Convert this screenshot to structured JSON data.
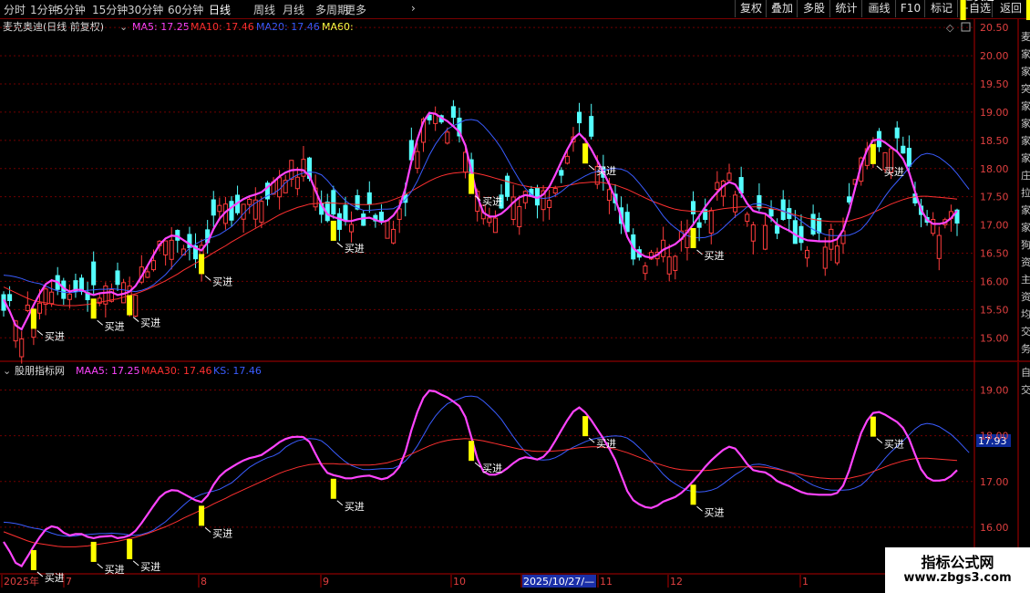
{
  "toolbar": {
    "periods": [
      "分时",
      "1分钟",
      "5分钟",
      "15分钟",
      "30分钟",
      "60分钟",
      "日线",
      "周线",
      "月线",
      "多周期",
      "更多"
    ],
    "active_period": "日线",
    "more_arrow": "›",
    "buttons": [
      "复权",
      "叠加",
      "多股",
      "统计",
      "画线",
      "F10",
      "标记",
      "+自选",
      "返回"
    ]
  },
  "main_panel": {
    "title": "麦克奥迪(日线 前复权)",
    "ma5": "MA5: 17.25",
    "ma10": "MA10: 17.46",
    "ma20": "MA20: 17.46",
    "ma60": "MA60:",
    "right_strip_text": "麦家家突家家家家庄拉家家狗资主资均交务"
  },
  "sub_panel": {
    "title": "股朋指标网",
    "maa5": "MAA5: 17.25",
    "maa30": "MAA30: 17.46",
    "ks": "KS: 17.46",
    "current_value": "17.93",
    "right_strip_text": "自交"
  },
  "date_axis": {
    "labels": [
      "2025年",
      "7",
      "8",
      "9",
      "10",
      "2025/10/27/—",
      "11",
      "12",
      "1"
    ]
  },
  "watermark": {
    "line1": "指标公式网",
    "line2": "www.zbgs3.com"
  },
  "colors": {
    "up": "#ff3c3c",
    "down": "#54ffff",
    "ma5": "#ff44ff",
    "ma10": "#ff3030",
    "ma20": "#3a5cff",
    "ma60": "#ffff44",
    "buy": "#ffff00",
    "grid": "#700000"
  },
  "chart_data": [
    {
      "type": "candlestick",
      "title": "麦克奥迪(日线 前复权)",
      "y_ticks": [
        15.0,
        15.5,
        16.0,
        16.5,
        17.0,
        17.5,
        18.0,
        18.5,
        19.0,
        19.5,
        20.0,
        20.5
      ],
      "ylim": [
        14.6,
        20.6
      ],
      "buy_signal_label": "买进",
      "buy_signals_x_index": [
        5,
        15,
        21,
        33,
        55,
        78,
        97,
        115,
        145,
        160,
        171,
        192
      ],
      "series": [
        {
          "name": "MA5",
          "values": [
            15.68,
            15.47,
            15.22,
            15.15,
            15.36,
            15.58,
            15.78,
            15.95,
            16.02,
            15.99,
            15.88,
            15.82,
            15.85,
            15.85,
            15.79,
            15.76,
            15.79,
            15.8,
            15.81,
            15.76,
            15.78,
            15.82,
            15.92,
            16.09,
            16.28,
            16.47,
            16.65,
            16.76,
            16.81,
            16.8,
            16.73,
            16.66,
            16.59,
            16.55,
            16.69,
            16.93,
            17.11,
            17.23,
            17.31,
            17.39,
            17.46,
            17.51,
            17.54,
            17.58,
            17.67,
            17.76,
            17.86,
            17.93,
            17.97,
            17.98,
            17.97,
            17.87,
            17.61,
            17.36,
            17.19,
            17.14,
            17.11,
            17.07,
            17.07,
            17.1,
            17.12,
            17.13,
            17.09,
            17.05,
            17.08,
            17.17,
            17.32,
            17.65,
            18.12,
            18.52,
            18.83,
            18.99,
            18.97,
            18.9,
            18.84,
            18.75,
            18.65,
            18.41,
            17.97,
            17.5,
            17.22,
            17.15,
            17.15,
            17.2,
            17.29,
            17.4,
            17.49,
            17.53,
            17.51,
            17.48,
            17.54,
            17.68,
            17.89,
            18.12,
            18.34,
            18.53,
            18.62,
            18.51,
            18.34,
            18.14,
            17.94,
            17.72,
            17.47,
            17.13,
            16.79,
            16.59,
            16.5,
            16.44,
            16.42,
            16.47,
            16.56,
            16.61,
            16.66,
            16.75,
            16.87,
            17.01,
            17.16,
            17.32,
            17.46,
            17.58,
            17.69,
            17.76,
            17.72,
            17.56,
            17.38,
            17.25,
            17.22,
            17.2,
            17.12,
            17.01,
            16.95,
            16.9,
            16.83,
            16.77,
            16.73,
            16.72,
            16.71,
            16.71,
            16.71,
            16.75,
            16.91,
            17.24,
            17.66,
            18.06,
            18.33,
            18.5,
            18.52,
            18.46,
            18.38,
            18.3,
            18.17,
            17.93,
            17.59,
            17.27,
            17.09,
            17.02,
            17.02,
            17.04,
            17.12,
            17.25
          ]
        },
        {
          "name": "MA20",
          "values": [
            16.11,
            16.1,
            16.08,
            16.05,
            16.01,
            15.98,
            15.96,
            15.92,
            15.87,
            15.83,
            15.81,
            15.8,
            15.81,
            15.83,
            15.84,
            15.85,
            15.86,
            15.86,
            15.87,
            15.86,
            15.85,
            15.83,
            15.82,
            15.84,
            15.88,
            15.94,
            16.03,
            16.12,
            16.24,
            16.36,
            16.48,
            16.59,
            16.66,
            16.72,
            16.76,
            16.79,
            16.83,
            16.9,
            16.97,
            17.08,
            17.2,
            17.31,
            17.39,
            17.46,
            17.52,
            17.56,
            17.63,
            17.75,
            17.83,
            17.89,
            17.92,
            17.94,
            17.93,
            17.89,
            17.79,
            17.66,
            17.54,
            17.43,
            17.35,
            17.3,
            17.26,
            17.26,
            17.27,
            17.28,
            17.28,
            17.29,
            17.35,
            17.45,
            17.59,
            17.78,
            18.01,
            18.24,
            18.43,
            18.58,
            18.7,
            18.76,
            18.81,
            18.86,
            18.87,
            18.85,
            18.76,
            18.64,
            18.51,
            18.36,
            18.17,
            17.98,
            17.8,
            17.65,
            17.54,
            17.48,
            17.47,
            17.48,
            17.52,
            17.59,
            17.68,
            17.75,
            17.81,
            17.87,
            17.92,
            17.95,
            17.97,
            17.99,
            18.0,
            17.99,
            17.95,
            17.86,
            17.74,
            17.61,
            17.46,
            17.31,
            17.16,
            17.04,
            16.95,
            16.87,
            16.81,
            16.78,
            16.77,
            16.78,
            16.81,
            16.86,
            16.95,
            17.05,
            17.15,
            17.23,
            17.32,
            17.37,
            17.38,
            17.36,
            17.32,
            17.29,
            17.25,
            17.2,
            17.15,
            17.07,
            16.99,
            16.92,
            16.87,
            16.83,
            16.81,
            16.81,
            16.81,
            16.82,
            16.86,
            16.92,
            17.04,
            17.19,
            17.35,
            17.51,
            17.65,
            17.77,
            17.89,
            18.02,
            18.15,
            18.24,
            18.27,
            18.25,
            18.2,
            18.12,
            18.03,
            17.91,
            17.77,
            17.63
          ]
        },
        {
          "name": "MA10",
          "values": [
            15.9,
            15.85,
            15.8,
            15.75,
            15.7,
            15.66,
            15.64,
            15.62,
            15.6,
            15.58,
            15.57,
            15.57,
            15.57,
            15.58,
            15.59,
            15.61,
            15.63,
            15.65,
            15.67,
            15.69,
            15.72,
            15.75,
            15.78,
            15.82,
            15.86,
            15.91,
            15.96,
            16.01,
            16.07,
            16.13,
            16.2,
            16.26,
            16.32,
            16.38,
            16.44,
            16.51,
            16.57,
            16.63,
            16.7,
            16.76,
            16.82,
            16.88,
            16.94,
            17.0,
            17.06,
            17.12,
            17.18,
            17.23,
            17.27,
            17.31,
            17.34,
            17.37,
            17.38,
            17.39,
            17.39,
            17.39,
            17.38,
            17.38,
            17.37,
            17.36,
            17.36,
            17.36,
            17.37,
            17.39,
            17.41,
            17.45,
            17.49,
            17.54,
            17.6,
            17.66,
            17.72,
            17.78,
            17.83,
            17.87,
            17.9,
            17.92,
            17.93,
            17.94,
            17.93,
            17.91,
            17.89,
            17.86,
            17.83,
            17.8,
            17.77,
            17.74,
            17.71,
            17.69,
            17.67,
            17.66,
            17.66,
            17.66,
            17.67,
            17.68,
            17.7,
            17.72,
            17.74,
            17.75,
            17.76,
            17.76,
            17.75,
            17.73,
            17.71,
            17.67,
            17.63,
            17.58,
            17.53,
            17.48,
            17.43,
            17.39,
            17.35,
            17.31,
            17.28,
            17.26,
            17.25,
            17.24,
            17.24,
            17.24,
            17.25,
            17.27,
            17.29,
            17.3,
            17.31,
            17.32,
            17.32,
            17.32,
            17.32,
            17.31,
            17.29,
            17.27,
            17.24,
            17.21,
            17.18,
            17.15,
            17.12,
            17.1,
            17.08,
            17.07,
            17.06,
            17.06,
            17.06,
            17.07,
            17.1,
            17.13,
            17.17,
            17.22,
            17.27,
            17.32,
            17.37,
            17.41,
            17.45,
            17.48,
            17.5,
            17.51,
            17.51,
            17.5,
            17.49,
            17.48,
            17.47,
            17.46
          ]
        }
      ]
    },
    {
      "type": "line",
      "title": "股朋指标网",
      "y_ticks": [
        16.0,
        17.0,
        18.0,
        19.0
      ],
      "ylim": [
        15.0,
        19.55
      ],
      "buy_signal_label": "买进",
      "series": [
        {
          "name": "MAA5",
          "ref": "MA5"
        },
        {
          "name": "MAA30",
          "ref": "MA10"
        },
        {
          "name": "KS",
          "ref": "MA20"
        }
      ]
    }
  ]
}
